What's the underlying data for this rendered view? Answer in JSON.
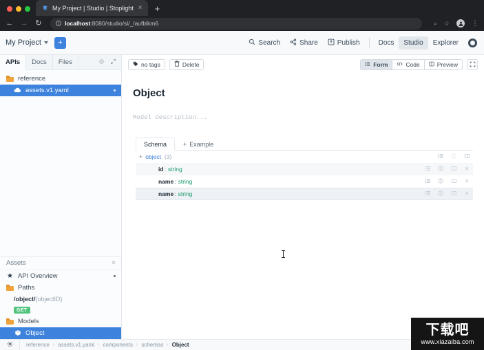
{
  "browser": {
    "tab": {
      "title": "My Project | Studio | Stoplight",
      "favicon": "stoplight-icon",
      "close": "×"
    },
    "new_tab": "+",
    "nav": {
      "back": "←",
      "forward": "→",
      "reload": "↻"
    },
    "omnibox": {
      "info_icon": "i",
      "url_host": "localhost",
      "url_path": ":8080/studio/sl/_/aufblkm6"
    },
    "actions": {
      "zoom": "⌕",
      "bookmark": "☆",
      "profile": "avatar-icon",
      "menu": "⋮"
    }
  },
  "app_header": {
    "project_name": "My Project",
    "add_label": "+",
    "items": [
      {
        "label": "Search",
        "icon": "search-icon"
      },
      {
        "label": "Share",
        "icon": "share-icon"
      },
      {
        "label": "Publish",
        "icon": "publish-icon"
      }
    ],
    "nav": [
      {
        "label": "Docs",
        "active": false
      },
      {
        "label": "Studio",
        "active": true
      },
      {
        "label": "Explorer",
        "active": false
      }
    ]
  },
  "sidebar": {
    "tabs": [
      {
        "label": "APIs",
        "active": true
      },
      {
        "label": "Docs",
        "active": false
      },
      {
        "label": "Files",
        "active": false
      }
    ],
    "tab_actions": {
      "settings": "gear-icon",
      "collapse": "expand-icon"
    },
    "tree": [
      {
        "label": "reference",
        "icon": "folder-icon",
        "selected": false,
        "indent": 0
      },
      {
        "label": "assets.v1.yaml",
        "icon": "cloud-icon",
        "selected": true,
        "indent": 1,
        "dot": true
      }
    ],
    "assets": {
      "title": "Assets",
      "close": "×",
      "items": [
        {
          "label": "API Overview",
          "icon": "star-icon",
          "selected": false,
          "dot": true
        },
        {
          "label": "Paths",
          "icon": "folder-icon",
          "selected": false
        },
        {
          "label": "Models",
          "icon": "folder-icon",
          "selected": false
        },
        {
          "label": "Object",
          "icon": "cube-icon",
          "selected": true
        }
      ],
      "path": {
        "bold": "/object/",
        "dim": "{objectID}",
        "method": "GET"
      }
    }
  },
  "main": {
    "toolbar": {
      "tags_label": "no tags",
      "tags_icon": "tag-icon",
      "delete_label": "Delete",
      "delete_icon": "trash-icon",
      "views": [
        {
          "label": "Form",
          "icon": "form-icon",
          "active": true
        },
        {
          "label": "Code",
          "icon": "code-icon",
          "active": false
        },
        {
          "label": "Preview",
          "icon": "preview-icon",
          "active": false
        }
      ],
      "expand_icon": "fullscreen-icon"
    },
    "title": "Object",
    "description_placeholder": "Model description...",
    "schema_tabs": [
      {
        "label": "Schema",
        "active": true
      },
      {
        "label": "Example",
        "active": false,
        "add": true,
        "prefix": "+"
      }
    ],
    "schema_rows": [
      {
        "expander": "+",
        "key": "object",
        "key_style": "blue",
        "type": "",
        "count": "(3)",
        "indent": false,
        "icons": [
          "list-icon",
          "info-icon",
          "book-icon"
        ]
      },
      {
        "expander": "",
        "key": "id",
        "key_style": "bold",
        "type": "string",
        "count": "",
        "indent": true,
        "icons": [
          "list-icon",
          "info-icon",
          "book-icon",
          "remove-icon"
        ]
      },
      {
        "expander": "",
        "key": "name",
        "key_style": "bold",
        "type": "string",
        "count": "",
        "indent": true,
        "icons": [
          "list-icon",
          "info-icon",
          "book-icon",
          "remove-icon"
        ]
      },
      {
        "expander": "",
        "key": "name",
        "key_style": "bold",
        "type": "string",
        "count": "",
        "indent": true,
        "icons": [
          "list-icon",
          "info-icon",
          "book-icon",
          "remove-icon"
        ]
      }
    ]
  },
  "statusbar": {
    "gear_icon": "gear-icon",
    "breadcrumbs": [
      "reference",
      "assets.v1.yaml",
      "components",
      "schemas",
      "Object"
    ],
    "separator": "›"
  },
  "watermark": {
    "chinese": "下载吧",
    "url": "www.xiazaiba.com"
  },
  "colors": {
    "accent": "#3d82dd",
    "chrome_bg": "#202124",
    "method_get": "#52c47f",
    "type_green": "#1a9a6c"
  }
}
